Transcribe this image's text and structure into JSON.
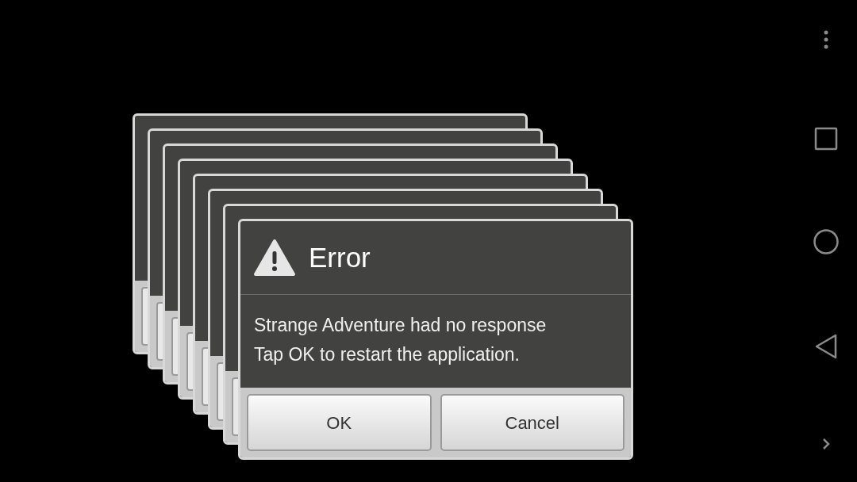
{
  "stacked_dialogs": [
    {
      "kind": "dialog"
    },
    {
      "kind": "dialog"
    },
    {
      "kind": "dialog"
    },
    {
      "kind": "dialog"
    },
    {
      "kind": "dialog"
    },
    {
      "kind": "dialog"
    },
    {
      "kind": "dialog"
    }
  ],
  "dialog": {
    "title": "Error",
    "message_lines": [
      "Strange Adventure had no response",
      "Tap OK to restart the application."
    ],
    "buttons": [
      "OK",
      "Cancel"
    ]
  },
  "nav_buttons": [
    {
      "kind": "menu"
    },
    {
      "kind": "recents"
    },
    {
      "kind": "home"
    },
    {
      "kind": "back"
    },
    {
      "kind": "expand"
    }
  ]
}
